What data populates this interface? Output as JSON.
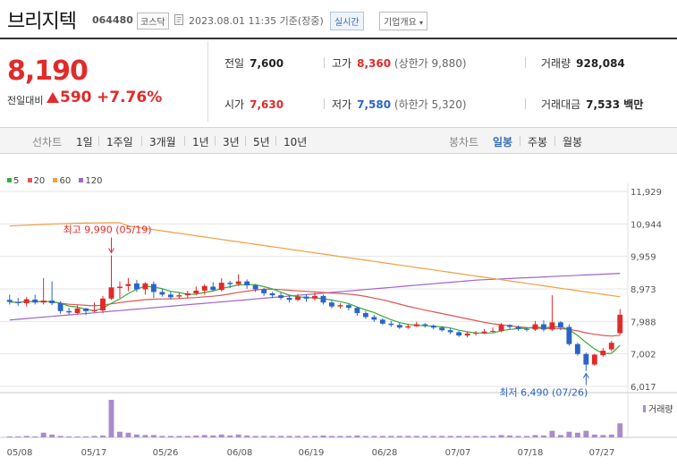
{
  "header": {
    "name": "브리지텍",
    "code": "064480",
    "market": "코스닥",
    "timestamp": "2023.08.01 11:35 기준(장중)",
    "realtime": "실시간",
    "company_info": "기업개요"
  },
  "summary": {
    "price": "8,190",
    "change_label": "전일대비",
    "change": "590",
    "change_pct": "+7.76%",
    "prev_label": "전일",
    "prev": "7,600",
    "high_label": "고가",
    "high": "8,360",
    "upper_limit": "(상한가 9,880)",
    "volume_label": "거래량",
    "volume": "928,084",
    "open_label": "시가",
    "open": "7,630",
    "low_label": "저가",
    "low": "7,580",
    "lower_limit": "(하한가 5,320)",
    "amount_label": "거래대금",
    "amount": "7,533 백만"
  },
  "period": {
    "line_label": "선차트",
    "options": [
      "1일",
      "1주일",
      "3개월",
      "1년",
      "3년",
      "5년",
      "10년"
    ],
    "candle_label": "봉차트",
    "candle_options": [
      "일봉",
      "주봉",
      "월봉"
    ],
    "active": "일봉"
  },
  "colors": {
    "up": "#e12a2a",
    "down": "#2b64c8",
    "ma5": "#3aab3a",
    "ma20": "#e05555",
    "ma60": "#f0a040",
    "ma120": "#a066cc"
  },
  "chart_data": {
    "type": "candlestick",
    "legend": [
      "5",
      "20",
      "60",
      "120"
    ],
    "yticks": [
      "11,929",
      "10,944",
      "9,959",
      "8,973",
      "7,988",
      "7,002",
      "6,017"
    ],
    "ylim": [
      6017,
      11929
    ],
    "xticks": [
      "05/08",
      "05/17",
      "05/26",
      "06/08",
      "06/19",
      "06/28",
      "07/07",
      "07/18",
      "07/27"
    ],
    "high_annot": "최고 9,990 (05/19)",
    "low_annot": "최저 6,490 (07/26)",
    "volume_label": "거래량",
    "candles": [
      [
        8640,
        8580,
        8800,
        8500
      ],
      [
        8580,
        8540,
        8700,
        8460
      ],
      [
        8540,
        8660,
        8720,
        8440
      ],
      [
        8650,
        8560,
        8800,
        8500
      ],
      [
        8560,
        8620,
        9300,
        8500
      ],
      [
        8620,
        8540,
        9200,
        8480
      ],
      [
        8540,
        8300,
        8600,
        8220
      ],
      [
        8300,
        8260,
        8400,
        8200
      ],
      [
        8240,
        8380,
        8480,
        8200
      ],
      [
        8380,
        8300,
        8400,
        8180
      ],
      [
        8300,
        8320,
        8560,
        8260
      ],
      [
        8320,
        8680,
        8760,
        8240
      ],
      [
        8680,
        9020,
        9990,
        8640
      ],
      [
        9000,
        9040,
        9200,
        8700
      ],
      [
        9060,
        9120,
        9300,
        8900
      ],
      [
        9140,
        8960,
        9240,
        8880
      ],
      [
        8960,
        9140,
        9180,
        8800
      ],
      [
        9120,
        8880,
        9200,
        8700
      ],
      [
        8880,
        8800,
        8980,
        8740
      ],
      [
        8800,
        8720,
        8900,
        8660
      ],
      [
        8740,
        8780,
        8860,
        8680
      ],
      [
        8780,
        8840,
        8920,
        8700
      ],
      [
        8840,
        8920,
        9040,
        8780
      ],
      [
        8920,
        9060,
        9120,
        8800
      ],
      [
        9040,
        8940,
        9180,
        8900
      ],
      [
        8940,
        9160,
        9300,
        8900
      ],
      [
        9160,
        9120,
        9220,
        9000
      ],
      [
        9120,
        9200,
        9420,
        9060
      ],
      [
        9200,
        9080,
        9260,
        8980
      ],
      [
        9080,
        8960,
        9120,
        8880
      ],
      [
        8960,
        8840,
        9000,
        8760
      ],
      [
        8840,
        8780,
        8880,
        8700
      ],
      [
        8780,
        8700,
        8860,
        8640
      ],
      [
        8700,
        8640,
        8780,
        8560
      ],
      [
        8640,
        8740,
        8820,
        8600
      ],
      [
        8740,
        8680,
        8800,
        8580
      ],
      [
        8680,
        8760,
        8860,
        8620
      ],
      [
        8760,
        8560,
        8800,
        8500
      ],
      [
        8560,
        8440,
        8620,
        8380
      ],
      [
        8440,
        8480,
        8540,
        8380
      ],
      [
        8480,
        8400,
        8520,
        8320
      ],
      [
        8400,
        8240,
        8440,
        8160
      ],
      [
        8240,
        8120,
        8300,
        8060
      ],
      [
        8120,
        8040,
        8180,
        7980
      ],
      [
        8040,
        7920,
        8080,
        7880
      ],
      [
        7920,
        7880,
        8000,
        7820
      ],
      [
        7880,
        7800,
        7960,
        7760
      ],
      [
        7800,
        7840,
        7920,
        7760
      ],
      [
        7840,
        7900,
        7980,
        7820
      ],
      [
        7900,
        7860,
        7940,
        7800
      ],
      [
        7860,
        7800,
        7900,
        7740
      ],
      [
        7800,
        7720,
        7840,
        7680
      ],
      [
        7720,
        7660,
        7780,
        7600
      ],
      [
        7660,
        7560,
        7700,
        7520
      ],
      [
        7560,
        7620,
        7680,
        7500
      ],
      [
        7620,
        7640,
        7700,
        7560
      ],
      [
        7640,
        7680,
        7760,
        7600
      ],
      [
        7680,
        7700,
        7800,
        7640
      ],
      [
        7700,
        7880,
        7940,
        7660
      ],
      [
        7880,
        7820,
        7900,
        7740
      ],
      [
        7820,
        7760,
        7860,
        7700
      ],
      [
        7760,
        7740,
        7820,
        7680
      ],
      [
        7740,
        7900,
        8000,
        7700
      ],
      [
        7900,
        7740,
        8020,
        7680
      ],
      [
        7740,
        7960,
        8780,
        7700
      ],
      [
        7960,
        7800,
        8000,
        7720
      ],
      [
        7820,
        7300,
        7900,
        7250
      ],
      [
        7300,
        7000,
        7340,
        6950
      ],
      [
        7000,
        6680,
        7040,
        6490
      ],
      [
        6680,
        6980,
        7000,
        6640
      ],
      [
        6960,
        7100,
        7180,
        6920
      ],
      [
        7140,
        7340,
        7400,
        7080
      ],
      [
        7630,
        8190,
        8360,
        7580
      ]
    ],
    "volumes": [
      2,
      2,
      3,
      2,
      10,
      6,
      3,
      2,
      2,
      2,
      3,
      4,
      80,
      12,
      10,
      6,
      5,
      5,
      3,
      3,
      3,
      3,
      4,
      5,
      4,
      6,
      4,
      6,
      4,
      3,
      3,
      3,
      3,
      3,
      3,
      3,
      3,
      4,
      3,
      3,
      3,
      4,
      3,
      3,
      3,
      3,
      3,
      3,
      3,
      3,
      3,
      3,
      3,
      3,
      3,
      3,
      3,
      3,
      5,
      4,
      3,
      3,
      5,
      4,
      14,
      5,
      12,
      10,
      14,
      6,
      5,
      6,
      30
    ]
  }
}
